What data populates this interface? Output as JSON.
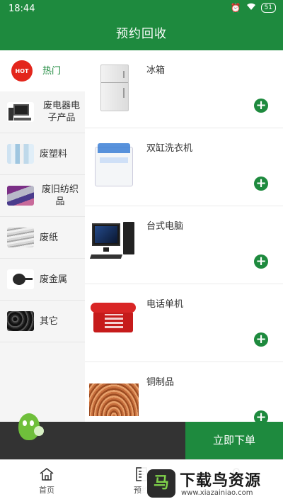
{
  "status_bar": {
    "time": "18:44",
    "battery": "51",
    "icons": [
      "alarm-icon",
      "wifi-icon",
      "signal-icon",
      "battery-icon"
    ]
  },
  "header": {
    "title": "预约回收"
  },
  "sidebar": {
    "items": [
      {
        "label": "热门",
        "badge": "HOT",
        "active": true
      },
      {
        "label": "废电器电子产品",
        "active": false
      },
      {
        "label": "废塑料",
        "active": false
      },
      {
        "label": "废旧纺织品",
        "active": false
      },
      {
        "label": "废纸",
        "active": false
      },
      {
        "label": "废金属",
        "active": false
      },
      {
        "label": "其它",
        "active": false
      }
    ]
  },
  "products": [
    {
      "name": "冰箱",
      "icon": "fridge-image"
    },
    {
      "name": "双缸洗衣机",
      "icon": "washing-machine-image"
    },
    {
      "name": "台式电脑",
      "icon": "desktop-computer-image"
    },
    {
      "name": "电话单机",
      "icon": "telephone-image"
    },
    {
      "name": "铜制品",
      "icon": "copper-image"
    }
  ],
  "order_bar": {
    "button_label": "立即下单"
  },
  "tab_bar": {
    "tabs": [
      {
        "label": "首页",
        "icon": "home-icon"
      },
      {
        "label": "预约",
        "icon": "document-icon"
      },
      {
        "label": "",
        "icon": "user-icon"
      }
    ]
  },
  "watermark": {
    "logo_char": "马",
    "title": "下载鸟资源",
    "url": "www.xiazainiao.com"
  },
  "colors": {
    "primary": "#1e8a3e",
    "hot": "#e3261c",
    "dark_bar": "#333333"
  }
}
